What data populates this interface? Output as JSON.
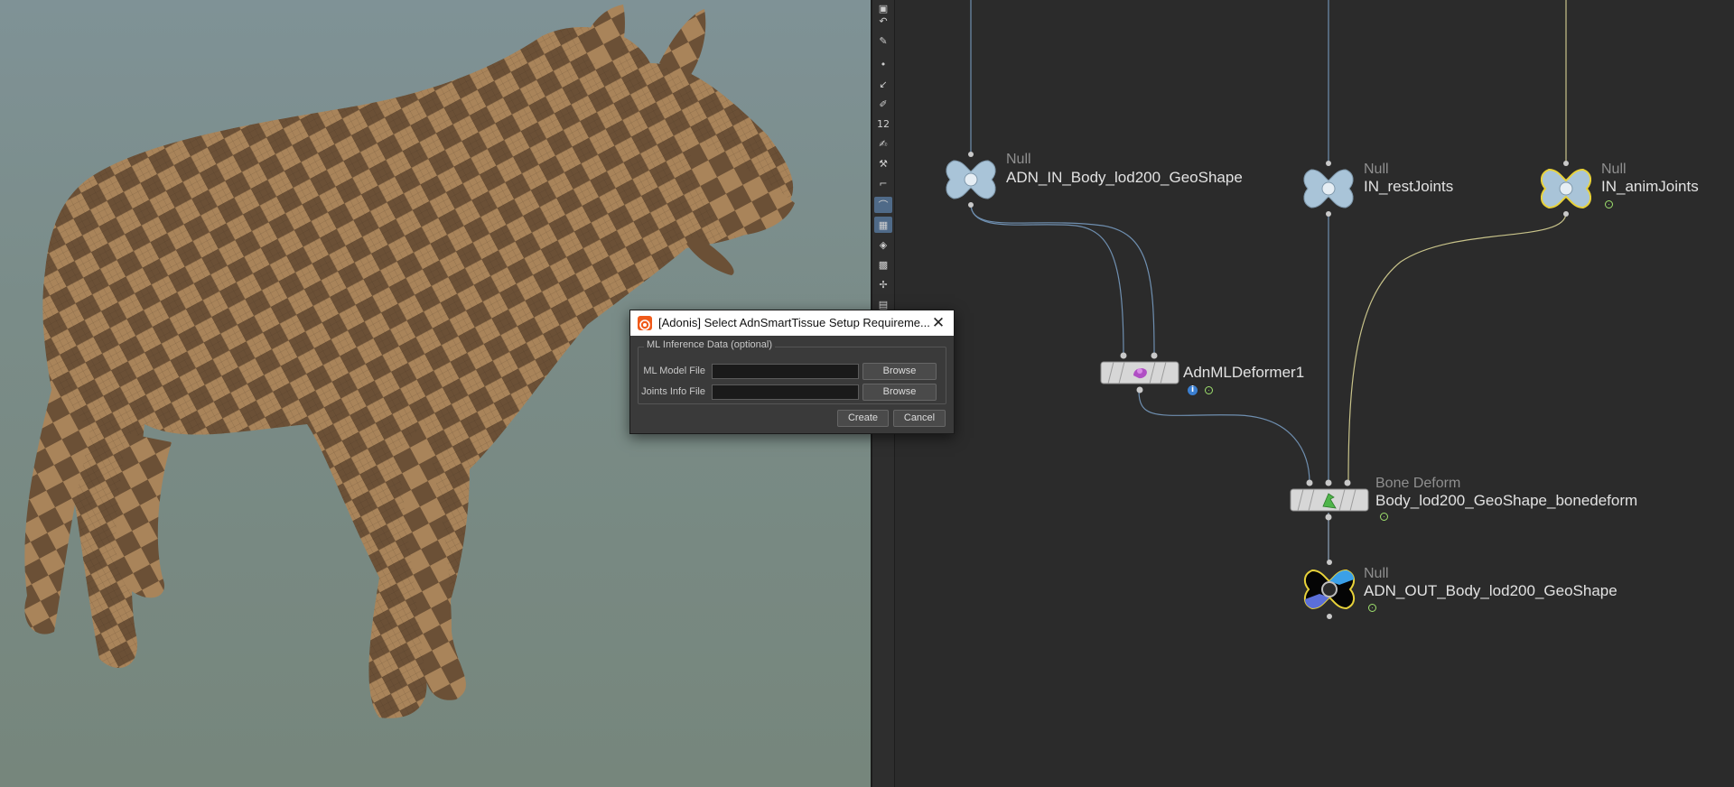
{
  "dialog": {
    "title": "[Adonis] Select AdnSmartTissue Setup Requireme...",
    "close_glyph": "✕",
    "group_title": "ML Inference Data (optional)",
    "fields": [
      {
        "label": "ML Model File",
        "value": "",
        "button": "Browse"
      },
      {
        "label": "Joints Info File",
        "value": "",
        "button": "Browse"
      }
    ],
    "create_label": "Create",
    "cancel_label": "Cancel"
  },
  "network": {
    "nodes": [
      {
        "type": "Null",
        "name": "ADN_IN_Body_lod200_GeoShape"
      },
      {
        "type": "Null",
        "name": "IN_restJoints"
      },
      {
        "type": "Null",
        "name": "IN_animJoints"
      },
      {
        "type": "",
        "name": "AdnMLDeformer1",
        "info_flag": "i"
      },
      {
        "type": "Bone Deform",
        "name": "Body_lod200_GeoShape_bonedeform"
      },
      {
        "type": "Null",
        "name": "ADN_OUT_Body_lod200_GeoShape"
      }
    ]
  },
  "toolbar": {
    "icons": [
      "select-icon",
      "lasso-icon",
      "brush-select-icon",
      "point-icon",
      "curve-icon",
      "pen-icon",
      "number-icon",
      "paint-icon",
      "stamp-icon",
      "edge-icon",
      "sculpt-icon",
      "uv-icon",
      "transform-icon",
      "mesh-icon",
      "pivot-icon",
      "grid-icon"
    ],
    "number_glyph": "12"
  },
  "colors": {
    "network_bg": "#2b2b2b",
    "null_node": "#a9c4d8",
    "selected_outline": "#e8d23a",
    "wire": "#6f8fb0",
    "wire_yellow": "#c8c38a",
    "flag_green": "#9ee06d"
  }
}
